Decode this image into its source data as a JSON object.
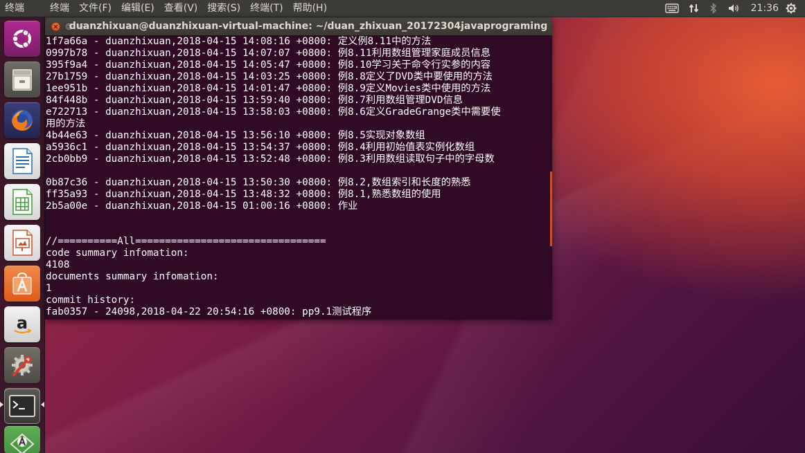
{
  "panel": {
    "app_name": "终端",
    "menus": [
      "终端",
      "文件(F)",
      "编辑(E)",
      "查看(V)",
      "搜索(S)",
      "终端(T)",
      "帮助(H)"
    ],
    "clock": "21:36"
  },
  "terminal": {
    "title": "duanzhixuan@duanzhixuan-virtual-machine: ~/duan_zhixuan_20172304javaprograming",
    "lines": [
      "1f7a66a - duanzhixuan,2018-04-15 14:08:16 +0800: 定义例8.11中的方法",
      "0997b78 - duanzhixuan,2018-04-15 14:07:07 +0800: 例8.11利用数组管理家庭成员信息",
      "395f9a4 - duanzhixuan,2018-04-15 14:05:47 +0800: 例8.10学习关于命令行实参的内容",
      "27b1759 - duanzhixuan,2018-04-15 14:03:25 +0800: 例8.8定义了DVD类中要使用的方法",
      "1ee951b - duanzhixuan,2018-04-15 14:01:47 +0800: 例8.9定义Movies类中使用的方法",
      "84f448b - duanzhixuan,2018-04-15 13:59:40 +0800: 例8.7利用数组管理DVD信息",
      "e722713 - duanzhixuan,2018-04-15 13:58:03 +0800: 例8.6定义GradeGrange类中需要使",
      "用的方法",
      "4b44e63 - duanzhixuan,2018-04-15 13:56:10 +0800: 例8.5实现对象数组",
      "a5936c1 - duanzhixuan,2018-04-15 13:54:37 +0800: 例8.4利用初始值表实例化数组",
      "2cb0bb9 - duanzhixuan,2018-04-15 13:52:48 +0800: 例8.3利用数组读取句子中的字母数",
      "",
      "0b87c36 - duanzhixuan,2018-04-15 13:50:30 +0800: 例8.2,数组索引和长度的熟悉",
      "ff35a93 - duanzhixuan,2018-04-15 13:48:32 +0800: 例8.1,熟悉数组的使用",
      "2b5a00e - duanzhixuan,2018-04-15 01:00:16 +0800: 作业",
      "",
      "",
      "//==========All================================",
      "code summary infomation:",
      "4108",
      "documents summary infomation:",
      "1",
      "commit history:",
      "fab0357 - 24098,2018-04-22 20:54:16 +0800: pp9.1测试程序"
    ]
  },
  "launcher": {
    "items": [
      "ubuntu-logo",
      "files",
      "firefox",
      "libreoffice-writer",
      "libreoffice-calc",
      "libreoffice-impress",
      "ubuntu-software",
      "amazon",
      "system-settings",
      "terminal",
      "software-updater"
    ]
  },
  "colors": {
    "terminal_bg": "#300a24",
    "panel_bg": "#3c3b37",
    "close_button": "#e95420",
    "scrollbar": "#c8552a"
  }
}
